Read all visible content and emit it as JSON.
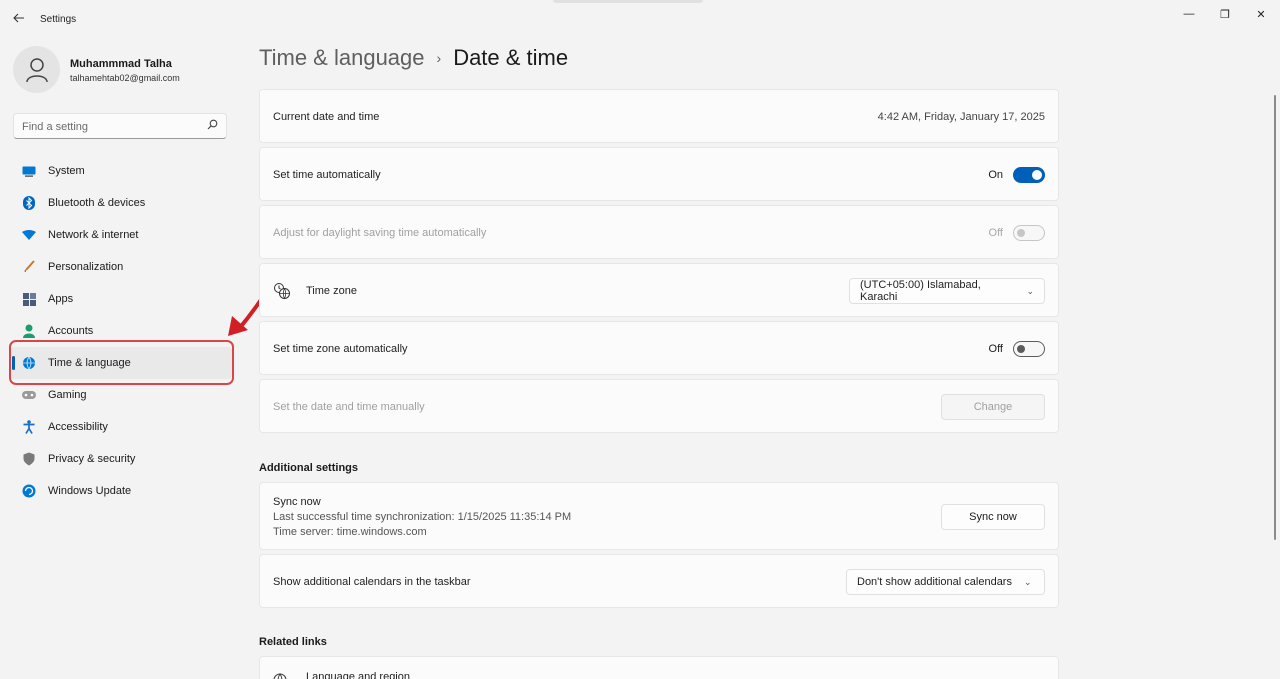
{
  "window": {
    "title": "Settings",
    "back_icon": "back-arrow-icon",
    "controls": {
      "minimize": "—",
      "maximize": "❐",
      "close": "✕"
    }
  },
  "profile": {
    "name": "Muhammmad Talha",
    "email": "talhamehtab02@gmail.com"
  },
  "search": {
    "placeholder": "Find a setting"
  },
  "sidebar": {
    "items": [
      {
        "label": "System",
        "icon": "monitor-icon",
        "color": "#0067c0"
      },
      {
        "label": "Bluetooth & devices",
        "icon": "bluetooth-icon",
        "color": "#0067c0"
      },
      {
        "label": "Network & internet",
        "icon": "wifi-icon",
        "color": "#0067c0"
      },
      {
        "label": "Personalization",
        "icon": "brush-icon",
        "color": "#c87a2a"
      },
      {
        "label": "Apps",
        "icon": "apps-icon",
        "color": "#4a5a78"
      },
      {
        "label": "Accounts",
        "icon": "person-icon",
        "color": "#1f9c6b"
      },
      {
        "label": "Time & language",
        "icon": "globe-clock-icon",
        "color": "#0067c0",
        "active": true
      },
      {
        "label": "Gaming",
        "icon": "gamepad-icon",
        "color": "#8a8a8a"
      },
      {
        "label": "Accessibility",
        "icon": "accessibility-icon",
        "color": "#1a6ec4"
      },
      {
        "label": "Privacy & security",
        "icon": "shield-icon",
        "color": "#6b6b6b"
      },
      {
        "label": "Windows Update",
        "icon": "update-icon",
        "color": "#0067c0"
      }
    ]
  },
  "breadcrumb": {
    "parent": "Time & language",
    "separator": "›",
    "current": "Date & time"
  },
  "settings": {
    "current_date_time": {
      "label": "Current date and time",
      "value": "4:42 AM, Friday, January 17, 2025"
    },
    "set_time_auto": {
      "label": "Set time automatically",
      "state": "On"
    },
    "daylight_saving": {
      "label": "Adjust for daylight saving time automatically",
      "state": "Off"
    },
    "time_zone": {
      "label": "Time zone",
      "value": "(UTC+05:00) Islamabad, Karachi"
    },
    "set_tz_auto": {
      "label": "Set time zone automatically",
      "state": "Off"
    },
    "manual": {
      "label": "Set the date and time manually",
      "button": "Change"
    }
  },
  "additional": {
    "title": "Additional settings",
    "sync": {
      "label": "Sync now",
      "last_sync": "Last successful time synchronization: 1/15/2025 11:35:14 PM",
      "server": "Time server: time.windows.com",
      "button": "Sync now"
    },
    "calendars": {
      "label": "Show additional calendars in the taskbar",
      "value": "Don't show additional calendars"
    }
  },
  "related": {
    "title": "Related links",
    "first_link": "Language and region"
  },
  "colors": {
    "accent": "#005fb8",
    "highlight": "#d9464a"
  }
}
